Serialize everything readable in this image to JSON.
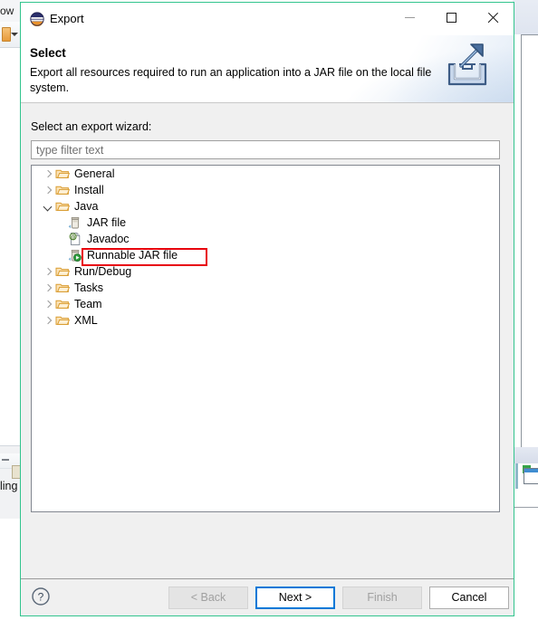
{
  "background": {
    "menu_fragment": "ow",
    "lower_label_fragment": "ling",
    "toolbar_dropdown_icon": "caret-down-icon"
  },
  "window": {
    "title": "Export",
    "app_icon": "eclipse-icon",
    "controls": {
      "minimize": "minimize-icon",
      "maximize": "maximize-icon",
      "close": "close-icon"
    }
  },
  "header": {
    "title": "Select",
    "description": "Export all resources required to run an application into a JAR file on the local file system.",
    "banner_icon": "export-tray-arrow-icon"
  },
  "body": {
    "field_label": "Select an export wizard:",
    "filter": {
      "value": "",
      "placeholder": "type filter text"
    },
    "tree": [
      {
        "label": "General",
        "depth": 0,
        "icon": "folder-icon",
        "state": "collapsed",
        "selected": false
      },
      {
        "label": "Install",
        "depth": 0,
        "icon": "folder-icon",
        "state": "collapsed",
        "selected": false
      },
      {
        "label": "Java",
        "depth": 0,
        "icon": "folder-icon",
        "state": "expanded",
        "selected": false
      },
      {
        "label": "JAR file",
        "depth": 1,
        "icon": "jar-icon",
        "state": "leaf",
        "selected": false
      },
      {
        "label": "Javadoc",
        "depth": 1,
        "icon": "javadoc-icon",
        "state": "leaf",
        "selected": false
      },
      {
        "label": "Runnable JAR file",
        "depth": 1,
        "icon": "runnable-jar-icon",
        "state": "leaf",
        "selected": true
      },
      {
        "label": "Run/Debug",
        "depth": 0,
        "icon": "folder-icon",
        "state": "collapsed",
        "selected": false
      },
      {
        "label": "Tasks",
        "depth": 0,
        "icon": "folder-icon",
        "state": "collapsed",
        "selected": false
      },
      {
        "label": "Team",
        "depth": 0,
        "icon": "folder-icon",
        "state": "collapsed",
        "selected": false
      },
      {
        "label": "XML",
        "depth": 0,
        "icon": "folder-icon",
        "state": "collapsed",
        "selected": false
      }
    ],
    "highlight": {
      "target": "Runnable JAR file",
      "color": "#e8000d"
    }
  },
  "footer": {
    "help_icon": "help-question-icon",
    "buttons": [
      {
        "label": "< Back",
        "state": "disabled"
      },
      {
        "label": "Next >",
        "state": "default"
      },
      {
        "label": "Finish",
        "state": "disabled"
      },
      {
        "label": "Cancel",
        "state": "normal"
      }
    ]
  },
  "colors": {
    "dialog_border": "#32c48d",
    "accent_focus": "#0078d7",
    "highlight_red": "#e8000d",
    "folder_orange": "#e8a33d"
  }
}
